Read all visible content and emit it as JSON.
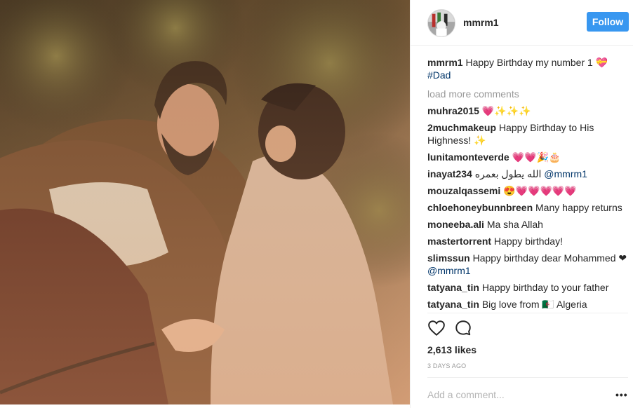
{
  "post": {
    "author": "mmrm1",
    "follow_label": "Follow",
    "caption_user": "mmrm1",
    "caption_text": "Happy Birthday my number 1 💝",
    "caption_tag": "#Dad",
    "load_more": "load more comments",
    "comments": [
      {
        "user": "muhra2015",
        "text": "💗✨✨✨"
      },
      {
        "user": "2muchmakeup",
        "text": "Happy Birthday to His Highness! ✨"
      },
      {
        "user": "lunitamonteverde",
        "text": "💗💗🎉🎂"
      },
      {
        "user": "inayat234",
        "text": "الله يطول بعمره",
        "mention": "@mmrm1"
      },
      {
        "user": "mouzalqassemi",
        "text": "😍💗💗💗💗💗"
      },
      {
        "user": "chloehoneybunnbreen",
        "text": "Many happy returns"
      },
      {
        "user": "moneeba.ali",
        "text": "Ma sha Allah"
      },
      {
        "user": "mastertorrent",
        "text": "Happy birthday!"
      },
      {
        "user": "slimssun",
        "text": "Happy birthday dear Mohammed ❤",
        "mention": "@mmrm1"
      },
      {
        "user": "tatyana_tin",
        "text": "Happy birthday to your father"
      },
      {
        "user": "tatyana_tin",
        "text": "Big love from 🇩🇿 Algeria"
      }
    ],
    "likes": "2,613 likes",
    "time": "3 DAYS AGO",
    "add_comment_placeholder": "Add a comment...",
    "more_label": "•••",
    "icons": {
      "like": "heart-icon",
      "comment": "comment-bubble-icon",
      "options": "more-options-icon"
    }
  },
  "colors": {
    "accent": "#3897f0",
    "link": "#003569",
    "muted": "#999999"
  }
}
